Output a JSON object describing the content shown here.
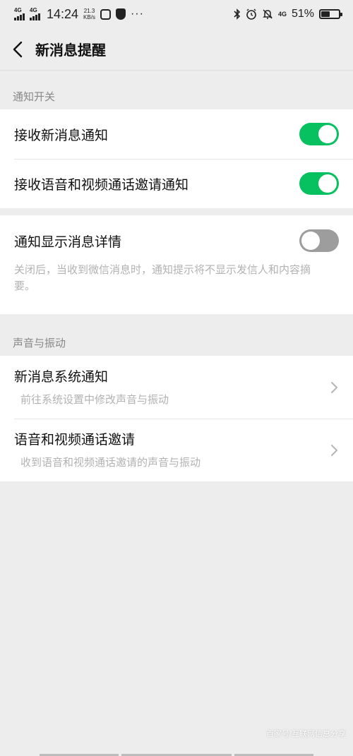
{
  "status_bar": {
    "signal1": "4G",
    "signal2": "4G",
    "time": "14:24",
    "speed_value": "21.3",
    "speed_unit": "KB/s",
    "dots": "···",
    "network": "4G",
    "battery": "51%",
    "battery_level": 0.51
  },
  "nav": {
    "title": "新消息提醒"
  },
  "sections": {
    "notify_switch": "通知开关",
    "sound_vibration": "声音与振动"
  },
  "toggles": [
    {
      "label": "接收新消息通知",
      "on": true
    },
    {
      "label": "接收语音和视频通话邀请通知",
      "on": true
    }
  ],
  "detail": {
    "label": "通知显示消息详情",
    "on": false,
    "description": "关闭后，当收到微信消息时，通知提示将不显示发信人和内容摘要。"
  },
  "sound_items": [
    {
      "title": "新消息系统通知",
      "subtitle": "前往系统设置中修改声音与振动"
    },
    {
      "title": "语音和视频通话邀请",
      "subtitle": "收到语音和视频通话邀请的声音与振动"
    }
  ],
  "watermark": "百家号/互联网信息分享",
  "colors": {
    "toggle_on": "#07c160",
    "toggle_off": "#9d9d9d",
    "background": "#ededed"
  }
}
